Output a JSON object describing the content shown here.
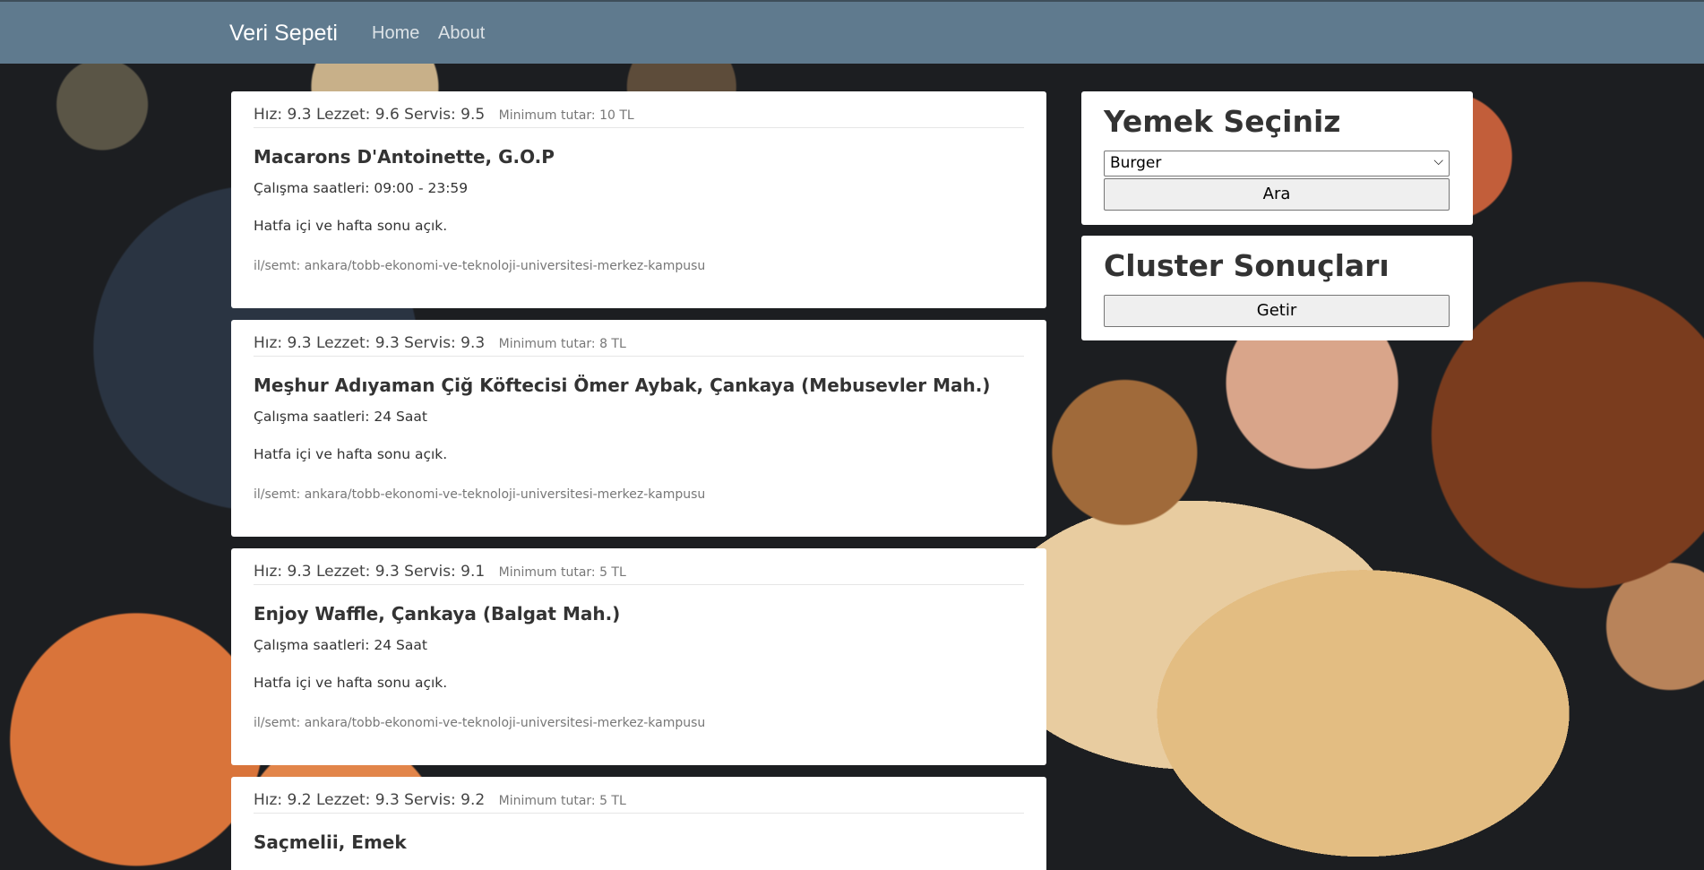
{
  "navbar": {
    "brand": "Veri Sepeti",
    "links": [
      "Home",
      "About"
    ]
  },
  "restaurants": [
    {
      "ratings": "Hız: 9.3 Lezzet: 9.6 Servis: 9.5",
      "minimum": "Minimum tutar: 10 TL",
      "name": "Macarons D'Antoinette, G.O.P",
      "hours": "Çalışma saatleri: 09:00 - 23:59",
      "open": "Hatfa içi ve hafta sonu açık.",
      "location": "il/semt: ankara/tobb-ekonomi-ve-teknoloji-universitesi-merkez-kampusu"
    },
    {
      "ratings": "Hız: 9.3 Lezzet: 9.3 Servis: 9.3",
      "minimum": "Minimum tutar: 8 TL",
      "name": "Meşhur Adıyaman Çiğ Köftecisi Ömer Aybak, Çankaya (Mebusevler Mah.)",
      "hours": "Çalışma saatleri: 24 Saat",
      "open": "Hatfa içi ve hafta sonu açık.",
      "location": "il/semt: ankara/tobb-ekonomi-ve-teknoloji-universitesi-merkez-kampusu"
    },
    {
      "ratings": "Hız: 9.3 Lezzet: 9.3 Servis: 9.1",
      "minimum": "Minimum tutar: 5 TL",
      "name": "Enjoy Waffle, Çankaya (Balgat Mah.)",
      "hours": "Çalışma saatleri: 24 Saat",
      "open": "Hatfa içi ve hafta sonu açık.",
      "location": "il/semt: ankara/tobb-ekonomi-ve-teknoloji-universitesi-merkez-kampusu"
    },
    {
      "ratings": "Hız: 9.2 Lezzet: 9.3 Servis: 9.2",
      "minimum": "Minimum tutar: 5 TL",
      "name": "Saçmelii, Emek",
      "hours": "",
      "open": "",
      "location": ""
    }
  ],
  "food_panel": {
    "title": "Yemek Seçiniz",
    "selected": "Burger",
    "search_label": "Ara"
  },
  "cluster_panel": {
    "title": "Cluster Sonuçları",
    "fetch_label": "Getir"
  }
}
